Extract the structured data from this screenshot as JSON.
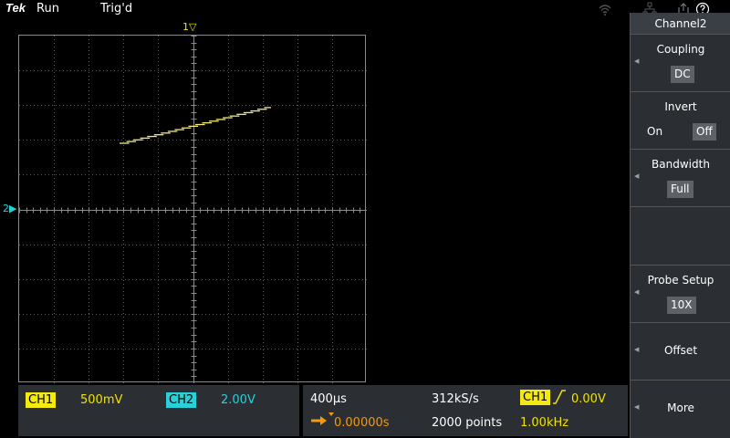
{
  "status": {
    "logo": "Tek",
    "acquisition": "Run",
    "trigger": "Trig'd"
  },
  "icons": [
    "wifi-icon",
    "network-icon",
    "export-icon",
    "help-icon"
  ],
  "markers": {
    "trigger_position": "1",
    "ch2_ground": "2"
  },
  "channels": {
    "ch1": {
      "label": "CH1",
      "scale": "500mV",
      "color": "#f5ea0f"
    },
    "ch2": {
      "label": "CH2",
      "scale": "2.00V",
      "color": "#2ad0d8"
    }
  },
  "timebase": {
    "scale": "400µs",
    "delay": "0.00000s",
    "sample_rate": "312kS/s",
    "record_length": "2000 points"
  },
  "trigger": {
    "source": "CH1",
    "level": "0.00V",
    "frequency": "1.00kHz"
  },
  "side_menu": {
    "title": "Channel2",
    "coupling": {
      "label": "Coupling",
      "value": "DC"
    },
    "invert": {
      "label": "Invert",
      "on": "On",
      "off": "Off",
      "selected": "Off"
    },
    "bandwidth": {
      "label": "Bandwidth",
      "value": "Full"
    },
    "probe_setup": {
      "label": "Probe Setup",
      "value": "10X"
    },
    "offset": {
      "label": "Offset"
    },
    "more": {
      "label": "More"
    }
  }
}
